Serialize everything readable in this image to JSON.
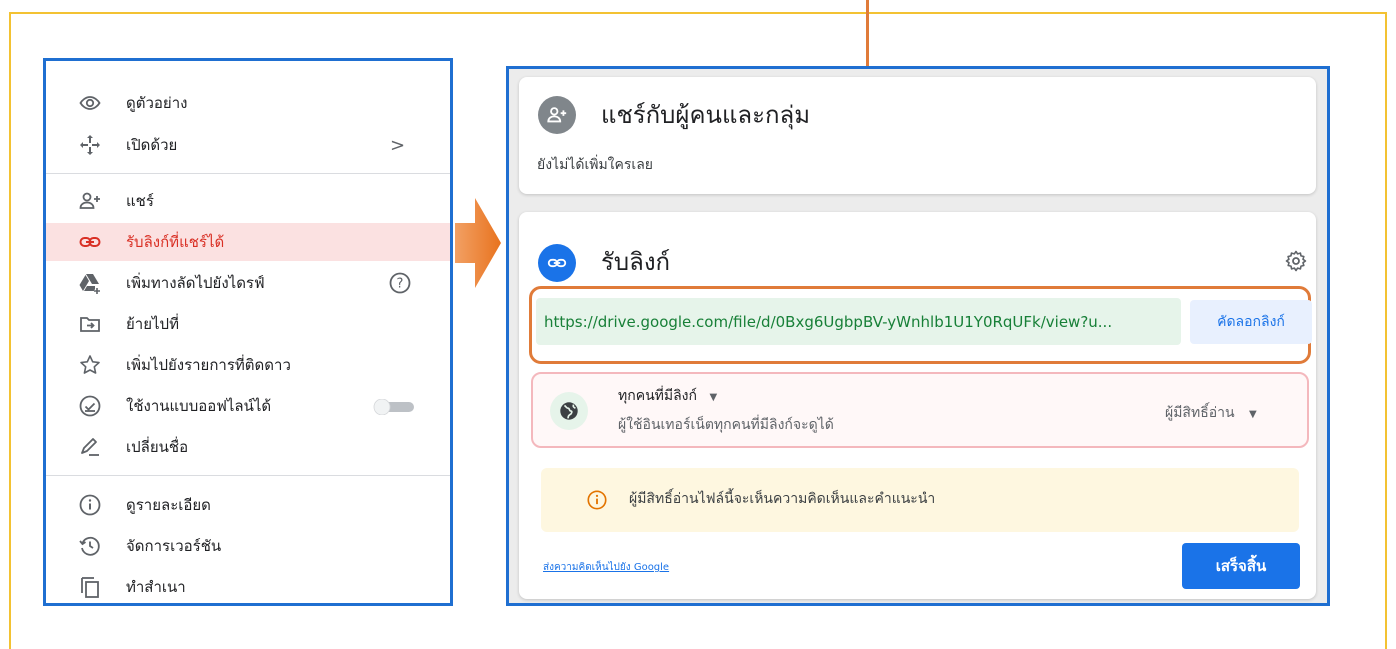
{
  "menu": {
    "items": [
      {
        "icon": "eye-icon",
        "label": "ดูตัวอย่าง"
      },
      {
        "icon": "open-with-icon",
        "label": "เปิดด้วย",
        "chevron": ">"
      },
      {
        "icon": "person-add-icon",
        "label": "แชร์"
      },
      {
        "icon": "link-icon",
        "label": "รับลิงก์ที่แชร์ได้"
      },
      {
        "icon": "drive-shortcut-icon",
        "label": "เพิ่มทางลัดไปยังไดรฟ์",
        "help": "?"
      },
      {
        "icon": "move-to-icon",
        "label": "ย้ายไปที่"
      },
      {
        "icon": "star-icon",
        "label": "เพิ่มไปยังรายการที่ติดดาว"
      },
      {
        "icon": "offline-icon",
        "label": "ใช้งานแบบออฟไลน์ได้"
      },
      {
        "icon": "rename-icon",
        "label": "เปลี่ยนชื่อ"
      },
      {
        "icon": "info-icon",
        "label": "ดูรายละเอียด"
      },
      {
        "icon": "history-icon",
        "label": "จัดการเวอร์ชัน"
      },
      {
        "icon": "copy-icon",
        "label": "ทำสำเนา"
      }
    ],
    "active_item": "รับลิงก์ที่แชร์ได้",
    "offline_toggle": false
  },
  "share_card": {
    "title": "แชร์กับผู้คนและกลุ่ม",
    "subtitle": "ยังไม่ได้เพิ่มใครเลย",
    "icon": "person-add-icon"
  },
  "link_card": {
    "title": "รับลิงก์",
    "icon": "link-icon",
    "url": "https://drive.google.com/file/d/0Bxg6UgbpBV-yWnhlb1U1Y0RqUFk/view?u...",
    "copy_label": "คัดลอกลิงก์",
    "access_title": "ทุกคนที่มีลิงก์",
    "access_subtitle": "ผู้ใช้อินเทอร์เน็ตทุกคนที่มีลิงก์จะดูได้",
    "role": "ผู้มีสิทธิ์อ่าน",
    "notice": "ผู้มีสิทธิ์อ่านไฟล์นี้จะเห็นความคิดเห็นและคำแนะนำ",
    "feedback_link": "ส่งความคิดเห็นไปยัง Google",
    "done_label": "เสร็จสิ้น"
  },
  "colors": {
    "frame": "#f3c232",
    "panel_border": "#1f6fd1",
    "highlight": "#e07b39",
    "active_bg": "#fbe1e1",
    "active_text": "#d93025",
    "primary": "#1a73e8"
  }
}
